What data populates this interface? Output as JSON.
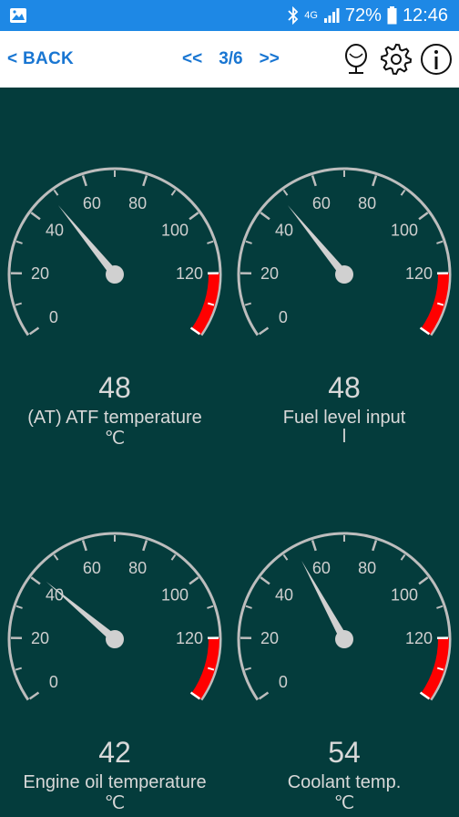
{
  "status_bar": {
    "icons": [
      "image-icon",
      "bluetooth-icon",
      "network-4g-icon",
      "signal-icon",
      "battery-icon"
    ],
    "network": "4G",
    "battery": "72%",
    "time": "12:46"
  },
  "toolbar": {
    "back_label": "< BACK",
    "prev_label": "<<",
    "page_indicator": "3/6",
    "next_label": ">>",
    "icons": [
      "voice-icon",
      "gear-icon",
      "info-icon"
    ],
    "accent_color": "#1976d2"
  },
  "gauge_scale": {
    "min": 0,
    "max": 140,
    "tick_labels": [
      "0",
      "20",
      "40",
      "60",
      "80",
      "100",
      "120"
    ],
    "red_zone_start": 120,
    "red_color": "#ff0000"
  },
  "gauges": [
    {
      "value": 48,
      "display": "48",
      "label": "(AT) ATF temperature",
      "unit": "℃"
    },
    {
      "value": 48,
      "display": "48",
      "label": "Fuel level input",
      "unit": "l"
    },
    {
      "value": 42,
      "display": "42",
      "label": "Engine oil temperature",
      "unit": "℃"
    },
    {
      "value": 54,
      "display": "54",
      "label": "Coolant temp.",
      "unit": "℃"
    }
  ]
}
